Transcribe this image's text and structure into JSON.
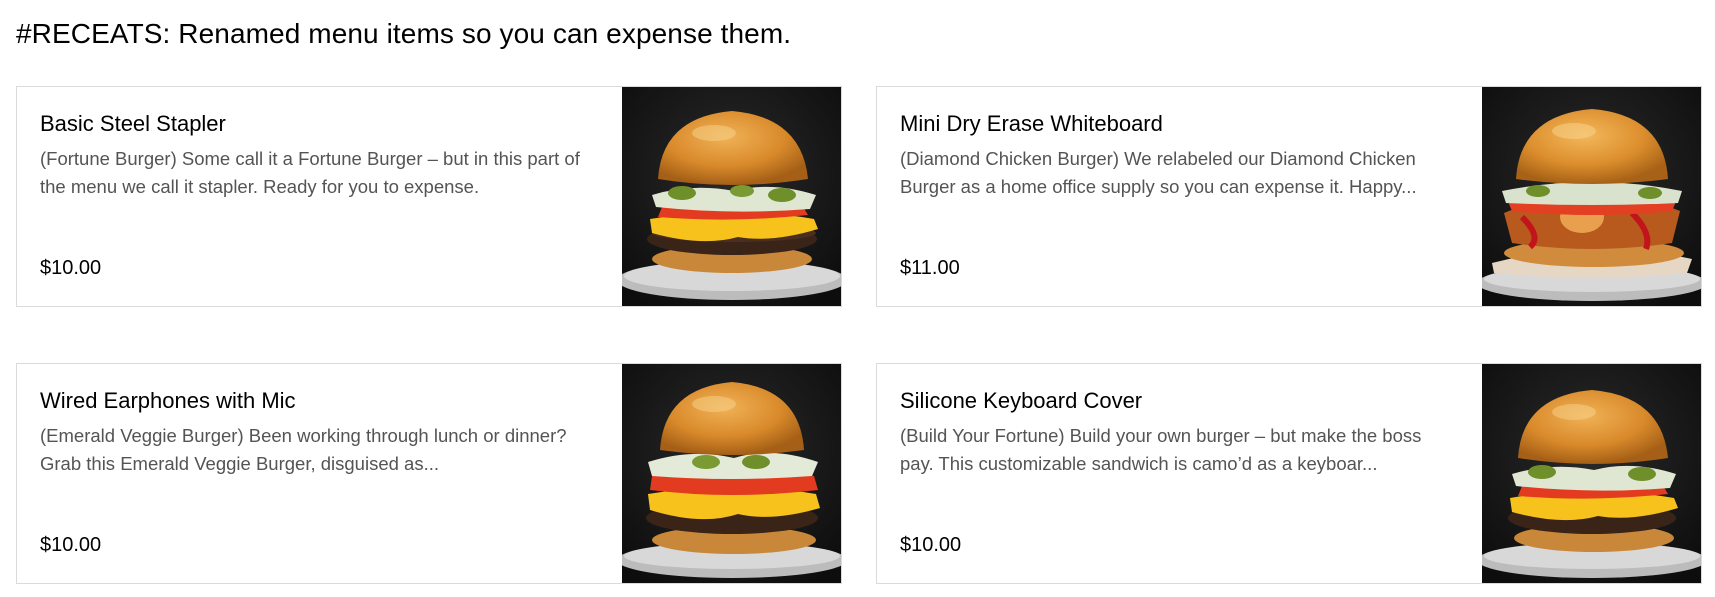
{
  "section": {
    "title": "#RECEATS: Renamed menu items so you can expense them."
  },
  "items": [
    {
      "name": "Basic Steel Stapler",
      "description": "(Fortune Burger) Some call it a Fortune Burger – but in this part of the menu we call it stapler. Ready for you to expense.",
      "price": "$10.00",
      "image_icon": "fortune-burger-photo"
    },
    {
      "name": "Mini Dry Erase Whiteboard",
      "description": "(Diamond Chicken Burger) We relabeled our Diamond Chicken Burger as a home office supply so you can expense it. Happy...",
      "price": "$11.00",
      "image_icon": "chicken-burger-photo"
    },
    {
      "name": "Wired Earphones with Mic",
      "description": "(Emerald Veggie Burger) Been working through lunch or dinner? Grab this Emerald Veggie Burger, disguised as...",
      "price": "$10.00",
      "image_icon": "veggie-burger-photo"
    },
    {
      "name": "Silicone Keyboard Cover",
      "description": "(Build Your Fortune) Build your own burger – but make the boss pay. This customizable sandwich is camo’d as a keyboar...",
      "price": "$10.00",
      "image_icon": "build-your-own-burger-photo"
    }
  ],
  "colors": {
    "background": "#ffffff",
    "card_border": "#dadada",
    "title_text": "#000000",
    "description_text": "#545454",
    "price_text": "#000000"
  }
}
